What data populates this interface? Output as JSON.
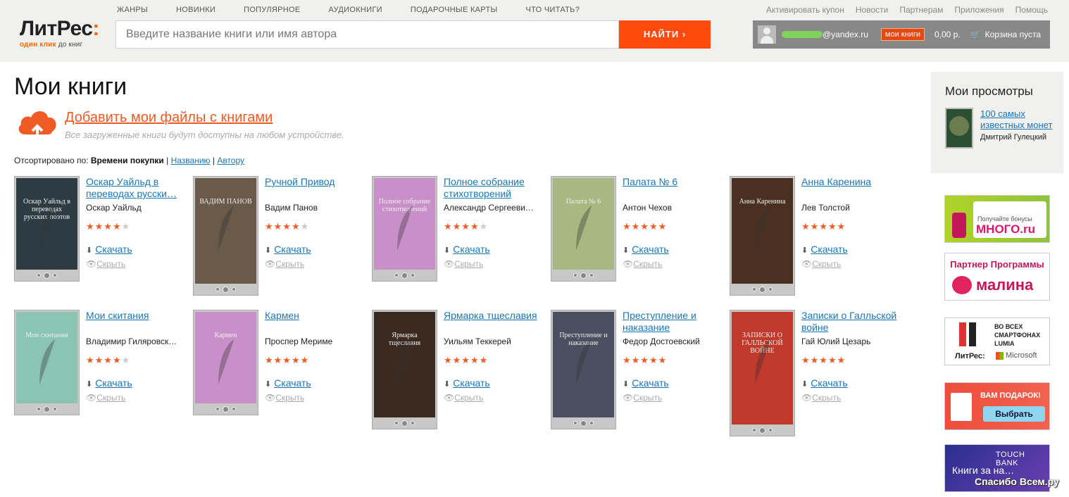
{
  "header": {
    "logo_main": "ЛитРес",
    "logo_colon": ":",
    "logo_sub_a": "один клик",
    "logo_sub_b": "до книг",
    "nav": [
      "Жанры",
      "Новинки",
      "Популярное",
      "Аудиокниги",
      "Подарочные карты",
      "Что читать?"
    ],
    "search_placeholder": "Введите название книги или имя автора",
    "search_button": "НАЙТИ ›",
    "toplinks": [
      "Активировать купон",
      "Новости",
      "Партнерам",
      "Приложения",
      "Помощь"
    ],
    "user_email_suffix": "@yandex.ru",
    "my_books_badge": "мои книги",
    "balance": "0,00 р.",
    "cart": "Корзина пуста"
  },
  "main": {
    "title": "Мои книги",
    "add_files": "Добавить мои файлы с книгами",
    "add_files_note": "Все загруженные книги будут доступны на любом устройстве.",
    "sort_prefix": "Отсортировано по:",
    "sort_active": "Времени покупки",
    "sort_by_name": "Названию",
    "sort_by_author": "Автору",
    "download_label": "Скачать",
    "hide_label": "Скрыть"
  },
  "books": [
    {
      "title": "Оскар Уайльд в переводах русски…",
      "author": "Оскар Уайльд",
      "rating": 4,
      "cover_color": "#2d3b42",
      "cover_text": "Оскар Уайльд в переводах русских поэтов"
    },
    {
      "title": "Ручной Привод",
      "author": "Вадим Панов",
      "rating": 4,
      "cover_color": "#6a5a4a",
      "cover_text": "ВАДИМ ПАНОВ"
    },
    {
      "title": "Полное собрание стихотворений",
      "author": "Александр Сергееви…",
      "rating": 4,
      "cover_color": "#c98fc8",
      "cover_text": "Полное собрание стихотворений"
    },
    {
      "title": "Палата № 6",
      "author": "Антон Чехов",
      "rating": 4.5,
      "cover_color": "#a8b880",
      "cover_text": "Палата № 6"
    },
    {
      "title": "Анна Каренина",
      "author": "Лев Толстой",
      "rating": 4.5,
      "cover_color": "#4a3020",
      "cover_text": "Анна Каренина"
    },
    {
      "title": "Мои скитания",
      "author": "Владимир Гиляровск…",
      "rating": 4,
      "cover_color": "#8cc4b4",
      "cover_text": "Мои скитания"
    },
    {
      "title": "Кармен",
      "author": "Проспер Мериме",
      "rating": 4.5,
      "cover_color": "#c98fc8",
      "cover_text": "Кармен"
    },
    {
      "title": "Ярмарка тщеславия",
      "author": "Уильям Теккерей",
      "rating": 4.5,
      "cover_color": "#3a2a20",
      "cover_text": "Ярмарка тщеславия"
    },
    {
      "title": "Преступление и наказание",
      "author": "Федор Достоевский",
      "rating": 4.5,
      "cover_color": "#4a5060",
      "cover_text": "Преступление и наказание"
    },
    {
      "title": "Записки о Галльской войне",
      "author": "Гай Юлий Цезарь",
      "rating": 4.5,
      "cover_color": "#c0392b",
      "cover_text": "ЗАПИСКИ О ГАЛЛЬСКОЙ ВОЙНЕ"
    }
  ],
  "sidebar": {
    "views_title": "Мои просмотры",
    "view_item_title": "100 самых известных монет",
    "view_item_author": "Дмитрий Гулецкий",
    "ad1_line1": "Получайте бонусы",
    "ad1_line2": "МНОГО.ru",
    "ad2_line1": "Партнер Программы",
    "ad2_line2": "малина",
    "ad3_line1": "ВО ВСЕХ СМАРТФОНАХ LUMIA",
    "ad3_line2": "ЛитРес:",
    "ad3_line3": "Microsoft",
    "ad4_line1": "ВАМ ПОДАРОК!",
    "ad4_button": "Выбрать",
    "ad5_line1": "TOUCH BANK",
    "ad5_line2": "Книги за на…",
    "watermark": "Спасибо Всем.ру"
  },
  "colors": {
    "accent": "#ff4a0e",
    "link": "#1a76b7",
    "star": "#ef5b25"
  }
}
